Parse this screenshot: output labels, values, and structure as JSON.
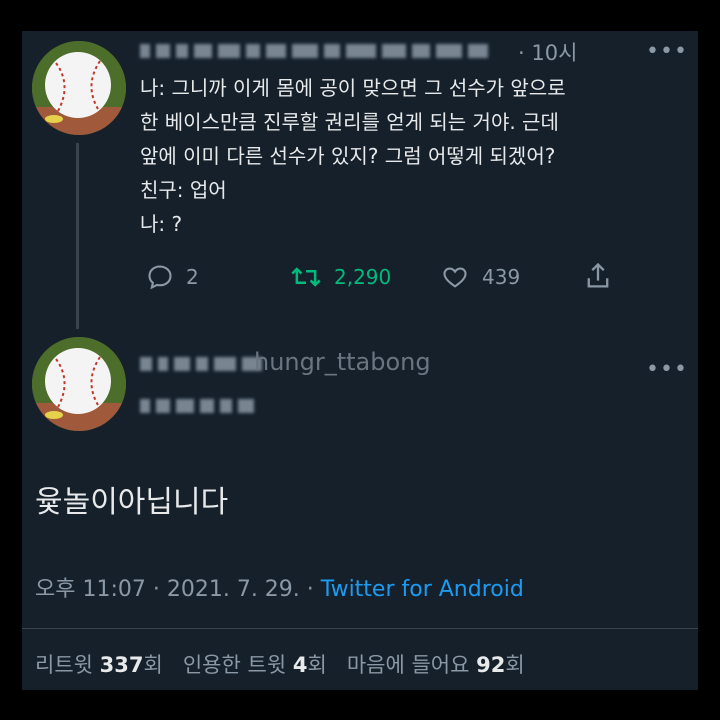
{
  "original_tweet": {
    "time": "· 10시",
    "more": "•••",
    "lines": [
      "나: 그니까 이게 몸에 공이 맞으면 그 선수가 앞으로",
      "한 베이스만큼 진루할 권리를 얻게 되는 거야. 근데",
      "앞에 이미 다른 선수가 있지? 그럼 어떻게 되겠어?",
      "친구: 업어",
      "나: ?"
    ],
    "actions": {
      "reply_count": "2",
      "retweet_count": "2,290",
      "like_count": "439"
    }
  },
  "reply_tweet": {
    "handle_fragment": "hungr_ttabong",
    "more": "•••",
    "text": "윷놀이아닙니다",
    "timestamp": "오후 11:07 · 2021. 7. 29. · ",
    "source": "Twitter for Android"
  },
  "stats": {
    "retweet_label": "리트윗",
    "retweet_count": "337",
    "retweet_unit": "회",
    "quote_label": "인용한 트윗",
    "quote_count": "4",
    "quote_unit": "회",
    "like_label": "마음에 들어요",
    "like_count": "92",
    "like_unit": "회"
  },
  "colors": {
    "background": "#15202b",
    "text": "#e7e9ea",
    "muted": "#8b98a5",
    "retweet_green": "#00ba7c",
    "link_blue": "#1d9bf0"
  }
}
